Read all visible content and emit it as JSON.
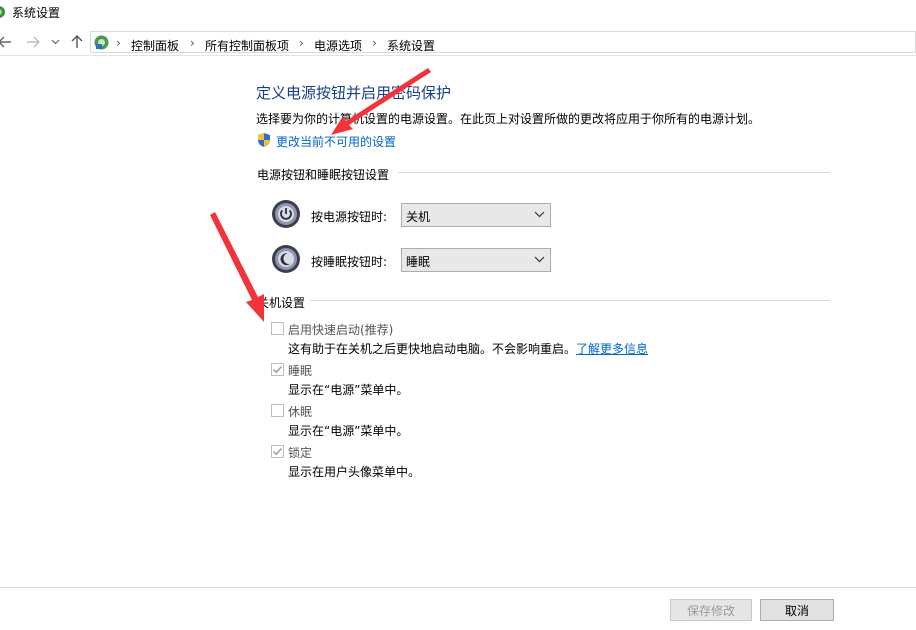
{
  "window": {
    "title": "系统设置"
  },
  "breadcrumb": [
    "控制面板",
    "所有控制面板项",
    "电源选项",
    "系统设置"
  ],
  "page": {
    "heading": "定义电源按钮并启用密码保护",
    "description": "选择要为你的计算机设置的电源设置。在此页上对设置所做的更改将应用于你所有的电源计划。",
    "change_link": "更改当前不可用的设置"
  },
  "power_section": {
    "title": "电源按钮和睡眠按钮设置",
    "power_button": {
      "label": "按电源按钮时:",
      "value": "关机"
    },
    "sleep_button": {
      "label": "按睡眠按钮时:",
      "value": "睡眠"
    }
  },
  "shutdown_section": {
    "title": "关机设置",
    "items": [
      {
        "label": "启用快速启动(推荐)",
        "desc": "这有助于在关机之后更快地启动电脑。不会影响重启。",
        "link": "了解更多信息",
        "checked": false
      },
      {
        "label": "睡眠",
        "desc": "显示在“电源”菜单中。",
        "checked": true
      },
      {
        "label": "休眠",
        "desc": "显示在“电源”菜单中。",
        "checked": false
      },
      {
        "label": "锁定",
        "desc": "显示在用户头像菜单中。",
        "checked": true
      }
    ]
  },
  "footer": {
    "save_label": "保存修改",
    "cancel_label": "取消"
  },
  "colors": {
    "heading": "#1a3e8c",
    "link": "#0066cc",
    "annotation_arrow": "#f0343a"
  }
}
